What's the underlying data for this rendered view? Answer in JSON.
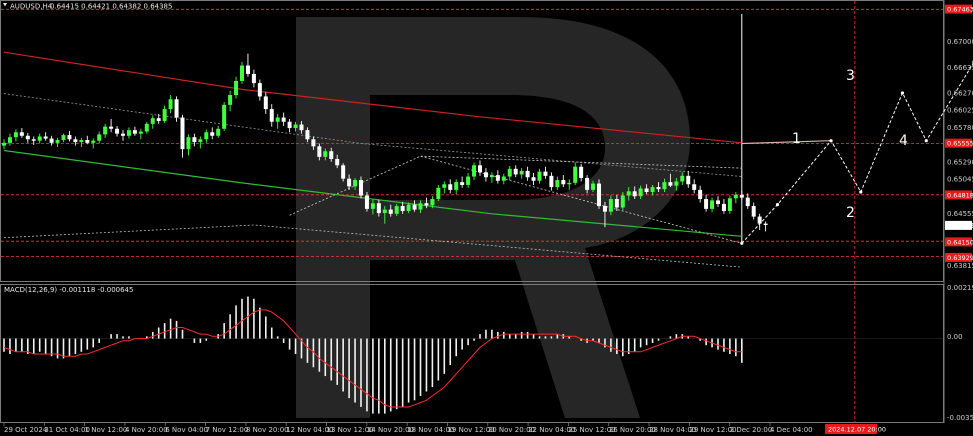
{
  "header": {
    "symbol": "AUDUSD,H4",
    "ohlc": "0.64415 0.64421 0.64382 0.64385"
  },
  "macd": {
    "label": "MACD(12,26,9) -0.001118 -0.000645",
    "scale": [
      "0.002191",
      "0.00",
      "-0.003588"
    ]
  },
  "price_scale": [
    "0.67000",
    "0.66635",
    "0.66270",
    "0.66025",
    "0.65780",
    "0.65290",
    "0.65045",
    "0.64555",
    "0.64385",
    "0.63815"
  ],
  "price_tags": [
    "0.67463",
    "0.65555",
    "0.64818",
    "0.64385",
    "0.64150",
    "0.63929"
  ],
  "time_labels": [
    "29 Oct 2024",
    "31 Oct 04:00",
    "1 Nov 12:00",
    "4 Nov 20:00",
    "6 Nov 04:00",
    "7 Nov 12:00",
    "8 Nov 20:00",
    "12 Nov 04:00",
    "13 Nov 12:00",
    "14 Nov 20:00",
    "18 Nov 04:00",
    "19 Nov 12:00",
    "20 Nov 20:00",
    "22 Nov 04:00",
    "25 Nov 12:00",
    "26 Nov 20:00",
    "28 Nov 04:00",
    "29 Nov 12:00",
    "2 Dec 20:00",
    "4 Dec 04:00"
  ],
  "time_tag": "2024.12.07 20:00",
  "wave_labels": [
    "1",
    "2",
    "3",
    "4"
  ],
  "colors": {
    "bull": "#3fff3f",
    "bear": "#ffffff",
    "ma_red": "#cc2222",
    "ma_green": "#33bb33",
    "signal": "#ff2a2a",
    "level_red": "#ff3333",
    "tag_red": "#e61c1c"
  },
  "chart_data": {
    "type": "candlestick",
    "symbol": "AUDUSD",
    "timeframe": "H4",
    "ylim": [
      0.6375,
      0.6745
    ],
    "last_price": 0.64385,
    "ohlc": [
      [
        0.6552,
        0.6561,
        0.6547,
        0.6556
      ],
      [
        0.6556,
        0.6569,
        0.6552,
        0.6564
      ],
      [
        0.6564,
        0.6575,
        0.6558,
        0.6571
      ],
      [
        0.6571,
        0.6577,
        0.6563,
        0.6566
      ],
      [
        0.6566,
        0.657,
        0.6556,
        0.6561
      ],
      [
        0.6561,
        0.6565,
        0.6553,
        0.6559
      ],
      [
        0.6559,
        0.6569,
        0.6555,
        0.6565
      ],
      [
        0.6565,
        0.6571,
        0.6559,
        0.6562
      ],
      [
        0.6562,
        0.6566,
        0.6552,
        0.6556
      ],
      [
        0.6556,
        0.6563,
        0.655,
        0.656
      ],
      [
        0.656,
        0.6569,
        0.6557,
        0.6567
      ],
      [
        0.6567,
        0.6573,
        0.6558,
        0.6561
      ],
      [
        0.6561,
        0.6565,
        0.6552,
        0.6557
      ],
      [
        0.6557,
        0.6563,
        0.655,
        0.656
      ],
      [
        0.656,
        0.6566,
        0.6554,
        0.6556
      ],
      [
        0.6556,
        0.6562,
        0.6548,
        0.6559
      ],
      [
        0.6559,
        0.6572,
        0.6555,
        0.6568
      ],
      [
        0.6568,
        0.6583,
        0.6563,
        0.6579
      ],
      [
        0.6579,
        0.659,
        0.6571,
        0.6576
      ],
      [
        0.6576,
        0.658,
        0.6565,
        0.6569
      ],
      [
        0.6569,
        0.6574,
        0.6559,
        0.6566
      ],
      [
        0.6566,
        0.6578,
        0.6562,
        0.6574
      ],
      [
        0.6574,
        0.6579,
        0.6566,
        0.6569
      ],
      [
        0.6569,
        0.6576,
        0.6561,
        0.6572
      ],
      [
        0.6572,
        0.6586,
        0.6569,
        0.6583
      ],
      [
        0.6583,
        0.6595,
        0.6576,
        0.6591
      ],
      [
        0.6591,
        0.6597,
        0.6583,
        0.6587
      ],
      [
        0.6587,
        0.6609,
        0.6584,
        0.6604
      ],
      [
        0.6604,
        0.6624,
        0.6598,
        0.6618
      ],
      [
        0.6618,
        0.6622,
        0.6586,
        0.6592
      ],
      [
        0.6592,
        0.6596,
        0.6535,
        0.6547
      ],
      [
        0.6547,
        0.6568,
        0.6538,
        0.6564
      ],
      [
        0.6564,
        0.6569,
        0.6551,
        0.6557
      ],
      [
        0.6557,
        0.6565,
        0.6548,
        0.6561
      ],
      [
        0.6561,
        0.6575,
        0.6556,
        0.6571
      ],
      [
        0.6571,
        0.6578,
        0.6561,
        0.6566
      ],
      [
        0.6566,
        0.658,
        0.6563,
        0.6576
      ],
      [
        0.6576,
        0.6614,
        0.6573,
        0.661
      ],
      [
        0.661,
        0.663,
        0.6601,
        0.6624
      ],
      [
        0.6624,
        0.665,
        0.6619,
        0.6644
      ],
      [
        0.6644,
        0.6671,
        0.664,
        0.6666
      ],
      [
        0.6666,
        0.6683,
        0.665,
        0.6654
      ],
      [
        0.6654,
        0.666,
        0.6635,
        0.6641
      ],
      [
        0.6641,
        0.6646,
        0.6616,
        0.6622
      ],
      [
        0.6622,
        0.6628,
        0.6597,
        0.6604
      ],
      [
        0.6604,
        0.6611,
        0.6579,
        0.6586
      ],
      [
        0.6586,
        0.6597,
        0.6576,
        0.6592
      ],
      [
        0.6592,
        0.6599,
        0.658,
        0.6586
      ],
      [
        0.6586,
        0.659,
        0.6571,
        0.6577
      ],
      [
        0.6577,
        0.6586,
        0.6572,
        0.6582
      ],
      [
        0.6582,
        0.6587,
        0.6569,
        0.6574
      ],
      [
        0.6574,
        0.6578,
        0.6557,
        0.6561
      ],
      [
        0.6561,
        0.6565,
        0.6546,
        0.6551
      ],
      [
        0.6551,
        0.6555,
        0.6531,
        0.6536
      ],
      [
        0.6536,
        0.6548,
        0.6531,
        0.6544
      ],
      [
        0.6544,
        0.6549,
        0.6529,
        0.6533
      ],
      [
        0.6533,
        0.6539,
        0.652,
        0.6524
      ],
      [
        0.6524,
        0.6527,
        0.6501,
        0.6505
      ],
      [
        0.6505,
        0.6511,
        0.6489,
        0.6494
      ],
      [
        0.6494,
        0.6506,
        0.6489,
        0.6503
      ],
      [
        0.6503,
        0.6508,
        0.6477,
        0.6481
      ],
      [
        0.6481,
        0.6486,
        0.6458,
        0.6462
      ],
      [
        0.6462,
        0.6475,
        0.6454,
        0.647
      ],
      [
        0.647,
        0.6475,
        0.6451,
        0.6456
      ],
      [
        0.6456,
        0.6466,
        0.6441,
        0.6461
      ],
      [
        0.6461,
        0.6468,
        0.6451,
        0.6455
      ],
      [
        0.6455,
        0.6469,
        0.6452,
        0.6466
      ],
      [
        0.6466,
        0.6472,
        0.6455,
        0.6459
      ],
      [
        0.6459,
        0.6471,
        0.6456,
        0.6468
      ],
      [
        0.6468,
        0.6474,
        0.6458,
        0.6461
      ],
      [
        0.6461,
        0.6474,
        0.6456,
        0.647
      ],
      [
        0.647,
        0.6478,
        0.6463,
        0.6467
      ],
      [
        0.6467,
        0.648,
        0.6463,
        0.6476
      ],
      [
        0.6476,
        0.6496,
        0.6473,
        0.6492
      ],
      [
        0.6492,
        0.6501,
        0.6484,
        0.6497
      ],
      [
        0.6497,
        0.6504,
        0.6484,
        0.6489
      ],
      [
        0.6489,
        0.6504,
        0.6483,
        0.65
      ],
      [
        0.65,
        0.6508,
        0.6492,
        0.6496
      ],
      [
        0.6496,
        0.6513,
        0.6492,
        0.6508
      ],
      [
        0.6508,
        0.6528,
        0.6503,
        0.6524
      ],
      [
        0.6524,
        0.6531,
        0.6509,
        0.6514
      ],
      [
        0.6514,
        0.652,
        0.6501,
        0.6507
      ],
      [
        0.6507,
        0.6514,
        0.6499,
        0.651
      ],
      [
        0.651,
        0.6517,
        0.6498,
        0.6502
      ],
      [
        0.6502,
        0.6512,
        0.6497,
        0.6508
      ],
      [
        0.6508,
        0.6523,
        0.6503,
        0.6519
      ],
      [
        0.6519,
        0.6524,
        0.6507,
        0.6511
      ],
      [
        0.6511,
        0.652,
        0.6505,
        0.6516
      ],
      [
        0.6516,
        0.6522,
        0.6502,
        0.6507
      ],
      [
        0.6507,
        0.6513,
        0.6496,
        0.6502
      ],
      [
        0.6502,
        0.6519,
        0.6498,
        0.6515
      ],
      [
        0.6515,
        0.6522,
        0.6505,
        0.6509
      ],
      [
        0.6509,
        0.6514,
        0.6488,
        0.6493
      ],
      [
        0.6493,
        0.6508,
        0.6489,
        0.6503
      ],
      [
        0.6503,
        0.651,
        0.6493,
        0.6497
      ],
      [
        0.6497,
        0.6504,
        0.6489,
        0.6499
      ],
      [
        0.6499,
        0.6528,
        0.6496,
        0.6522
      ],
      [
        0.6522,
        0.6526,
        0.6501,
        0.6506
      ],
      [
        0.6506,
        0.651,
        0.6484,
        0.6489
      ],
      [
        0.6489,
        0.6502,
        0.6486,
        0.6498
      ],
      [
        0.6498,
        0.6504,
        0.6462,
        0.6466
      ],
      [
        0.6466,
        0.6472,
        0.6436,
        0.6458
      ],
      [
        0.6458,
        0.6481,
        0.6453,
        0.6476
      ],
      [
        0.6476,
        0.6482,
        0.6459,
        0.6464
      ],
      [
        0.6464,
        0.6486,
        0.646,
        0.6481
      ],
      [
        0.6481,
        0.6493,
        0.6474,
        0.6487
      ],
      [
        0.6487,
        0.6494,
        0.6476,
        0.648
      ],
      [
        0.648,
        0.6495,
        0.6476,
        0.6491
      ],
      [
        0.6491,
        0.6497,
        0.6483,
        0.6486
      ],
      [
        0.6486,
        0.6496,
        0.6481,
        0.6493
      ],
      [
        0.6493,
        0.65,
        0.6486,
        0.649
      ],
      [
        0.649,
        0.6505,
        0.6486,
        0.65
      ],
      [
        0.65,
        0.6512,
        0.6493,
        0.6495
      ],
      [
        0.6495,
        0.6506,
        0.6488,
        0.6501
      ],
      [
        0.6501,
        0.6514,
        0.6496,
        0.6509
      ],
      [
        0.6509,
        0.6516,
        0.6492,
        0.6497
      ],
      [
        0.6497,
        0.6504,
        0.6484,
        0.6489
      ],
      [
        0.6489,
        0.6495,
        0.6471,
        0.6476
      ],
      [
        0.6476,
        0.6482,
        0.6458,
        0.6462
      ],
      [
        0.6462,
        0.6478,
        0.6457,
        0.6474
      ],
      [
        0.6474,
        0.648,
        0.6465,
        0.6469
      ],
      [
        0.6469,
        0.6476,
        0.6455,
        0.6459
      ],
      [
        0.6459,
        0.6481,
        0.6455,
        0.6477
      ],
      [
        0.6477,
        0.6486,
        0.647,
        0.6482
      ],
      [
        0.6482,
        0.6488,
        0.6475,
        0.6478
      ],
      [
        0.6478,
        0.6484,
        0.6462,
        0.6466
      ],
      [
        0.6466,
        0.6471,
        0.6447,
        0.6451
      ],
      [
        0.6451,
        0.6455,
        0.6432,
        0.6441
      ],
      [
        0.6441,
        0.6444,
        0.643,
        0.6439
      ]
    ],
    "overlays": {
      "ma_red": [
        [
          0,
          0.6685
        ],
        [
          40,
          0.6632
        ],
        [
          80,
          0.6593
        ],
        [
          124,
          0.6556
        ]
      ],
      "ma_green": [
        [
          0,
          0.6545
        ],
        [
          40,
          0.6499
        ],
        [
          82,
          0.6455
        ],
        [
          124,
          0.6423
        ]
      ],
      "channel_upper_dotted": [
        [
          0,
          0.6626
        ],
        [
          60,
          0.6555
        ],
        [
          124,
          0.6508
        ]
      ],
      "channel_lower_dotted": [
        [
          0,
          0.6421
        ],
        [
          42,
          0.6439
        ],
        [
          124,
          0.6379
        ]
      ],
      "triangle_dotted": [
        [
          48,
          0.6453
        ],
        [
          70,
          0.6537
        ],
        [
          124,
          0.6413
        ]
      ],
      "forecast_path": [
        [
          124,
          0.6413
        ],
        [
          130,
          0.6468
        ],
        [
          139,
          0.6559
        ],
        [
          144,
          0.6486
        ],
        [
          151,
          0.6627
        ],
        [
          155,
          0.6559
        ],
        [
          163,
          0.6671
        ],
        [
          165,
          0.6696
        ],
        [
          171,
          0.6559
        ],
        [
          180,
          0.6371
        ]
      ]
    },
    "levels": [
      0.6746,
      0.6555,
      0.6482,
      0.6416,
      0.6394
    ],
    "vertical_lines_at_bar": [
      124,
      143
    ],
    "macd": {
      "ylim": [
        -0.0036,
        0.0022
      ],
      "histogram": [
        -0.0006,
        -0.0007,
        -0.0006,
        -0.0006,
        -0.0007,
        -0.0007,
        -0.0006,
        -0.0007,
        -0.0008,
        -0.0009,
        -0.0009,
        -0.0008,
        -0.0007,
        -0.0006,
        -0.0005,
        -0.0004,
        -0.0002,
        0.0,
        0.0002,
        0.0002,
        0.0001,
        0.0001,
        0.0,
        0.0,
        0.0001,
        0.0003,
        0.0005,
        0.0007,
        0.0009,
        0.0008,
        0.0004,
        0.0,
        -0.0002,
        -0.0002,
        -0.0001,
        0.0,
        0.0002,
        0.0007,
        0.0011,
        0.0015,
        0.0018,
        0.0019,
        0.0018,
        0.0014,
        0.001,
        0.0005,
        0.0001,
        -0.0002,
        -0.0005,
        -0.0007,
        -0.0009,
        -0.0011,
        -0.0013,
        -0.0015,
        -0.0017,
        -0.0019,
        -0.0021,
        -0.0024,
        -0.0027,
        -0.0029,
        -0.0031,
        -0.0033,
        -0.0034,
        -0.0034,
        -0.0034,
        -0.0033,
        -0.0032,
        -0.0031,
        -0.0029,
        -0.0028,
        -0.0026,
        -0.0024,
        -0.0022,
        -0.0019,
        -0.0016,
        -0.0012,
        -0.0008,
        -0.0005,
        -0.0003,
        -0.0001,
        0.0002,
        0.0004,
        0.0004,
        0.0003,
        0.0003,
        0.0002,
        0.0002,
        0.0003,
        0.0003,
        0.0002,
        0.0001,
        0.0001,
        0.0001,
        0.0002,
        0.0002,
        0.0001,
        0.0,
        -0.0001,
        -0.0002,
        -0.0001,
        -0.0002,
        -0.0004,
        -0.0006,
        -0.0007,
        -0.0008,
        -0.0007,
        -0.0006,
        -0.0004,
        -0.0003,
        -0.0002,
        -0.0001,
        0.0,
        0.0001,
        0.0002,
        0.0002,
        0.0001,
        0.0,
        -0.0001,
        -0.0003,
        -0.0004,
        -0.0005,
        -0.0006,
        -0.0007,
        -0.0008,
        -0.0011
      ],
      "signal": [
        -0.0004,
        -0.0005,
        -0.0006,
        -0.0006,
        -0.0006,
        -0.0007,
        -0.0007,
        -0.0007,
        -0.0007,
        -0.0007,
        -0.0008,
        -0.0008,
        -0.0008,
        -0.0007,
        -0.0007,
        -0.0006,
        -0.0005,
        -0.0004,
        -0.0003,
        -0.0002,
        -0.0001,
        -0.0001,
        0.0,
        0.0,
        0.0,
        0.0001,
        0.0002,
        0.0003,
        0.0004,
        0.0005,
        0.0005,
        0.0004,
        0.0003,
        0.0002,
        0.0002,
        0.0001,
        0.0001,
        0.0002,
        0.0004,
        0.0006,
        0.0008,
        0.001,
        0.0012,
        0.0013,
        0.0013,
        0.0012,
        0.001,
        0.0008,
        0.0005,
        0.0002,
        -0.0001,
        -0.0004,
        -0.0006,
        -0.0009,
        -0.0011,
        -0.0013,
        -0.0015,
        -0.0017,
        -0.0019,
        -0.0021,
        -0.0023,
        -0.0025,
        -0.0027,
        -0.0028,
        -0.003,
        -0.0031,
        -0.0031,
        -0.0031,
        -0.0031,
        -0.003,
        -0.0029,
        -0.0028,
        -0.0026,
        -0.0024,
        -0.0022,
        -0.0019,
        -0.0016,
        -0.0013,
        -0.001,
        -0.0007,
        -0.0004,
        -0.0002,
        0.0,
        0.0001,
        0.0002,
        0.0002,
        0.0002,
        0.0002,
        0.0002,
        0.0002,
        0.0002,
        0.0002,
        0.0002,
        0.0002,
        0.0001,
        0.0001,
        0.0001,
        0.0,
        -0.0001,
        -0.0001,
        -0.0002,
        -0.0003,
        -0.0004,
        -0.0005,
        -0.0006,
        -0.0006,
        -0.0006,
        -0.0006,
        -0.0005,
        -0.0004,
        -0.0003,
        -0.0002,
        -0.0001,
        0.0,
        0.0001,
        0.0001,
        0.0001,
        0.0,
        -0.0001,
        -0.0002,
        -0.0003,
        -0.0004,
        -0.0005,
        -0.0006,
        -0.0006
      ]
    }
  }
}
